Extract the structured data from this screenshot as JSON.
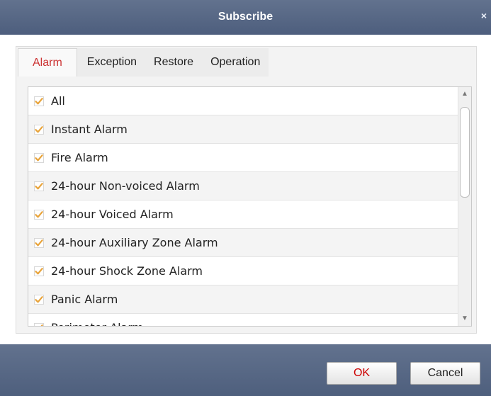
{
  "dialog": {
    "title": "Subscribe",
    "close_glyph": "×"
  },
  "tabs": [
    {
      "label": "Alarm",
      "active": true
    },
    {
      "label": "Exception",
      "active": false
    },
    {
      "label": "Restore",
      "active": false
    },
    {
      "label": "Operation",
      "active": false
    }
  ],
  "list": {
    "items": [
      {
        "label": "All",
        "checked": true
      },
      {
        "label": "Instant Alarm",
        "checked": true
      },
      {
        "label": "Fire Alarm",
        "checked": true
      },
      {
        "label": "24-hour Non-voiced Alarm",
        "checked": true
      },
      {
        "label": "24-hour Voiced Alarm",
        "checked": true
      },
      {
        "label": "24-hour Auxiliary Zone Alarm",
        "checked": true
      },
      {
        "label": "24-hour Shock Zone Alarm",
        "checked": true
      },
      {
        "label": "Panic Alarm",
        "checked": true
      },
      {
        "label": "Perimeter Alarm",
        "checked": true
      }
    ],
    "scroll_up_glyph": "▲",
    "scroll_down_glyph": "▼"
  },
  "buttons": {
    "ok_label": "OK",
    "cancel_label": "Cancel"
  },
  "colors": {
    "titlebar": "#56668a",
    "active_tab_text": "#cc3333",
    "checkbox_tick": "#e8a33a",
    "ok_text": "#cc0000"
  },
  "icons": {
    "check": "checkbox-checked-icon",
    "close": "close-icon"
  }
}
